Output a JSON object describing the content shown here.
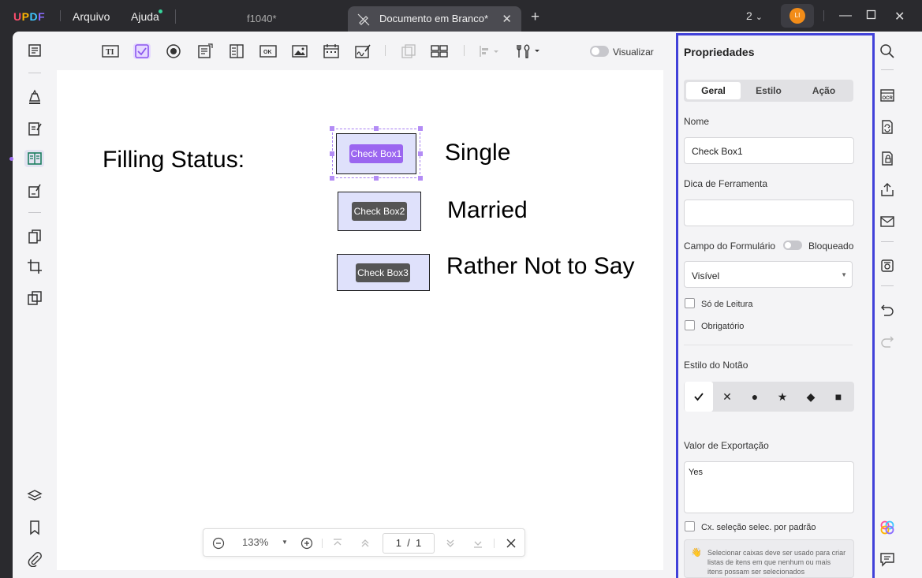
{
  "app": {
    "logo": "UPDF"
  },
  "menu": {
    "file": "Arquivo",
    "help": "Ajuda"
  },
  "tabs": [
    {
      "label": "f1040*"
    },
    {
      "label": "Documento em Branco*"
    }
  ],
  "titlebar": {
    "page_count": "2",
    "avatar_initials": "LI"
  },
  "toolbar": {
    "preview_label": "Visualizar"
  },
  "document": {
    "filling_status": "Filling Status:",
    "options": [
      {
        "text": "Single",
        "field": "Check Box1"
      },
      {
        "text": "Married",
        "field": "Check Box2"
      },
      {
        "text": "Rather Not to Say",
        "field": "Check Box3"
      }
    ]
  },
  "zoom": {
    "level": "133%",
    "current_page": "1",
    "separator": "/",
    "total_pages": "1"
  },
  "properties": {
    "title": "Propriedades",
    "tabs": [
      "Geral",
      "Estilo",
      "Ação"
    ],
    "name_label": "Nome",
    "name_value": "Check Box1",
    "tooltip_label": "Dica de Ferramenta",
    "tooltip_value": "",
    "form_field_label": "Campo do Formulário",
    "locked_label": "Bloqueado",
    "visibility_value": "Visível",
    "readonly_label": "Só de Leitura",
    "required_label": "Obrigatório",
    "button_style_label": "Estilo do Notão",
    "button_styles": [
      "check",
      "cross",
      "circle",
      "star",
      "diamond",
      "square"
    ],
    "export_label": "Valor de Exportação",
    "export_value": "Yes",
    "default_checked_label": "Cx. seleção selec. por padrão",
    "hint_text": "Selecionar caixas deve ser usado para criar listas de itens em que nenhum ou mais itens possam ser selecionados"
  },
  "colors": {
    "accent": "#9b66f0",
    "panel_border": "#4141d9",
    "checkbox_fill": "#dfe1fb"
  }
}
